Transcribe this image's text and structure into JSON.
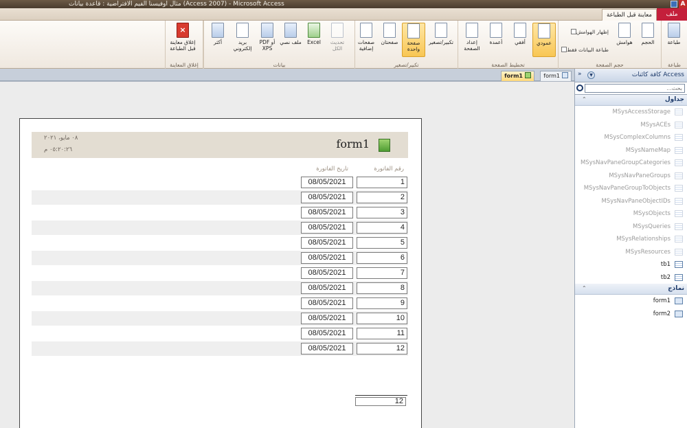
{
  "window": {
    "title": "مثال اوفيسنا الفيم الافتراضية : قاعدة بيانات (Access 2007) - Microsoft Access",
    "app_icon": "A"
  },
  "ribbon_tabs": {
    "file": "ملف",
    "preview": "معاينة قبل الطباعة"
  },
  "ribbon": {
    "print": {
      "print_label": "طباعة",
      "group_label": "طباعة"
    },
    "page_size": {
      "size_label": "الحجم",
      "margins_label": "هوامش",
      "show_margins": "إظهار الهوامش",
      "print_data_only": "طباعة البيانات فقط",
      "group_label": "حجم الصفحة"
    },
    "page_layout": {
      "portrait": "عمودي",
      "landscape": "أفقي",
      "columns": "أعمدة",
      "page_setup": "إعداد الصفحة",
      "group_label": "تخطيط الصفحة"
    },
    "zoom": {
      "zoom": "تكبير/تصغير",
      "one_page": "صفحة واحدة",
      "two_pages": "صفحتان",
      "more_pages": "صفحات إضافية",
      "group_label": "تكبير/تصغير"
    },
    "data": {
      "refresh_all": "تحديث الكل",
      "excel": "Excel",
      "text_file": "ملف نصي",
      "pdf_xps": "PDF أو XPS",
      "email": "بريد إلكتروني",
      "more": "أكثر",
      "group_label": "بيانات"
    },
    "close": {
      "close_preview": "إغلاق معاينة قبل الطباعة",
      "group_label": "إغلاق المعاينة"
    }
  },
  "doc_tabs": [
    {
      "label": "form1",
      "active": true
    },
    {
      "label": "form1",
      "active": false
    }
  ],
  "report": {
    "title": "form1",
    "date": "٠٨ مايو، ٢٠٢١",
    "time": "٠٥:٢٠:٢٦ م",
    "columns": {
      "id": "رقم الفاتورة",
      "date": "تاريخ الفاتورة"
    },
    "rows": [
      {
        "id": "1",
        "date": "08/05/2021"
      },
      {
        "id": "2",
        "date": "08/05/2021"
      },
      {
        "id": "3",
        "date": "08/05/2021"
      },
      {
        "id": "4",
        "date": "08/05/2021"
      },
      {
        "id": "5",
        "date": "08/05/2021"
      },
      {
        "id": "6",
        "date": "08/05/2021"
      },
      {
        "id": "7",
        "date": "08/05/2021"
      },
      {
        "id": "8",
        "date": "08/05/2021"
      },
      {
        "id": "9",
        "date": "08/05/2021"
      },
      {
        "id": "10",
        "date": "08/05/2021"
      },
      {
        "id": "11",
        "date": "08/05/2021"
      },
      {
        "id": "12",
        "date": "08/05/2021"
      }
    ],
    "total": "12"
  },
  "nav": {
    "title": "كافة كائنات Access",
    "search_placeholder": "بحث...",
    "tables_group": "جداول",
    "tables": [
      {
        "name": "MSysAccessStorage",
        "system": true
      },
      {
        "name": "MSysACEs",
        "system": true
      },
      {
        "name": "MSysComplexColumns",
        "system": true
      },
      {
        "name": "MSysNameMap",
        "system": true
      },
      {
        "name": "MSysNavPaneGroupCategories",
        "system": true
      },
      {
        "name": "MSysNavPaneGroups",
        "system": true
      },
      {
        "name": "MSysNavPaneGroupToObjects",
        "system": true
      },
      {
        "name": "MSysNavPaneObjectIDs",
        "system": true
      },
      {
        "name": "MSysObjects",
        "system": true
      },
      {
        "name": "MSysQueries",
        "system": true
      },
      {
        "name": "MSysRelationships",
        "system": true
      },
      {
        "name": "MSysResources",
        "system": true
      },
      {
        "name": "tb1",
        "system": false
      },
      {
        "name": "tb2",
        "system": false
      }
    ],
    "forms_group": "نماذج",
    "forms": [
      {
        "name": "form1"
      },
      {
        "name": "form2"
      }
    ]
  },
  "colors": {
    "file_tab": "#c41f3b",
    "active_button": "#f8c654",
    "header_band": "#e3ddd2",
    "row_shade": "#efefef"
  }
}
